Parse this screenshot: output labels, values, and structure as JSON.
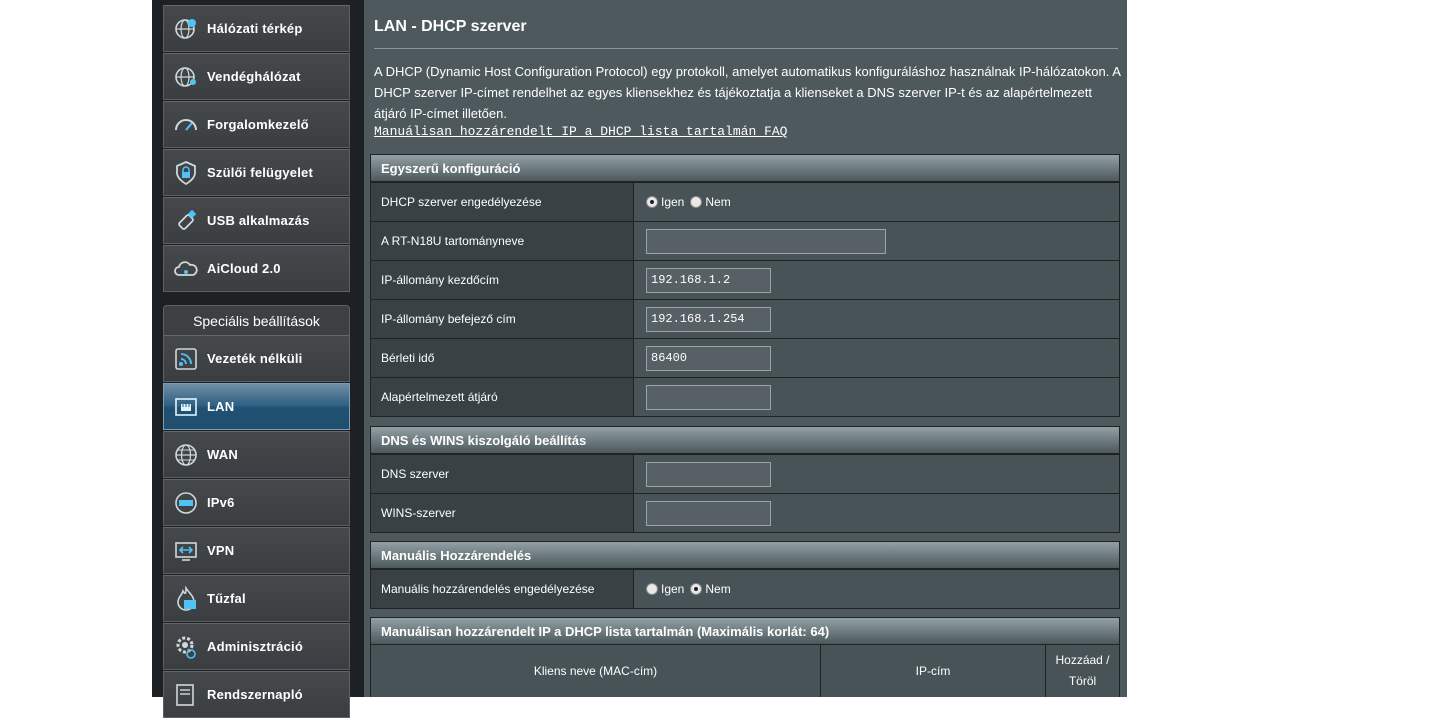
{
  "sidebar": {
    "top_items": [
      {
        "label": "Hálózati térkép",
        "icon": "globe-pin-icon"
      },
      {
        "label": "Vendéghálózat",
        "icon": "guest-network-icon"
      },
      {
        "label": "Forgalomkezelő",
        "icon": "speedometer-icon"
      },
      {
        "label": "Szülői felügyelet",
        "icon": "lock-shield-icon"
      },
      {
        "label": "USB alkalmazás",
        "icon": "usb-icon"
      },
      {
        "label": "AiCloud 2.0",
        "icon": "cloud-icon"
      }
    ],
    "section_title": "Speciális beállítások",
    "advanced_items": [
      {
        "label": "Vezeték nélküli",
        "icon": "wireless-icon"
      },
      {
        "label": "LAN",
        "icon": "lan-icon",
        "active": true
      },
      {
        "label": "WAN",
        "icon": "globe-icon"
      },
      {
        "label": "IPv6",
        "icon": "ipv6-icon"
      },
      {
        "label": "VPN",
        "icon": "vpn-icon"
      },
      {
        "label": "Tűzfal",
        "icon": "firewall-icon"
      },
      {
        "label": "Adminisztráció",
        "icon": "gear-icon"
      },
      {
        "label": "Rendszernapló",
        "icon": "log-icon"
      }
    ]
  },
  "main": {
    "title": "LAN - DHCP szerver",
    "description": "A DHCP (Dynamic Host Configuration Protocol) egy protokoll, amelyet automatikus konfiguráláshoz használnak IP-hálózatokon. A DHCP szerver IP-címet rendelhet az egyes kliensekhez és tájékoztatja a klienseket a DNS szerver IP-t és az alapértelmezett átjáró IP-címet illetően.",
    "faq_link": "Manuálisan hozzárendelt IP a DHCP lista tartalmán FAQ",
    "basic": {
      "header": "Egyszerű konfiguráció",
      "dhcp_enable_label": "DHCP szerver engedélyezése",
      "yes": "Igen",
      "no": "Nem",
      "domain_label": "A RT-N18U tartományneve",
      "domain_value": "",
      "start_label": "IP-állomány kezdőcím",
      "start_value": "192.168.1.2",
      "end_label": "IP-állomány befejező cím",
      "end_value": "192.168.1.254",
      "lease_label": "Bérleti idő",
      "lease_value": "86400",
      "gateway_label": "Alapértelmezett átjáró",
      "gateway_value": ""
    },
    "dns": {
      "header": "DNS és WINS kiszolgáló beállítás",
      "dns_label": "DNS szerver",
      "dns_value": "",
      "wins_label": "WINS-szerver",
      "wins_value": ""
    },
    "manual": {
      "header": "Manuális Hozzárendelés",
      "enable_label": "Manuális hozzárendelés engedélyezése",
      "yes": "Igen",
      "no": "Nem"
    },
    "list": {
      "header": "Manuálisan hozzárendelt IP a DHCP lista tartalmán (Maximális korlát: 64)",
      "col_client": "Kliens neve (MAC-cím)",
      "col_ip": "IP-cím",
      "col_action_1": "Hozzáad /",
      "col_action_2": "Töröl"
    }
  }
}
